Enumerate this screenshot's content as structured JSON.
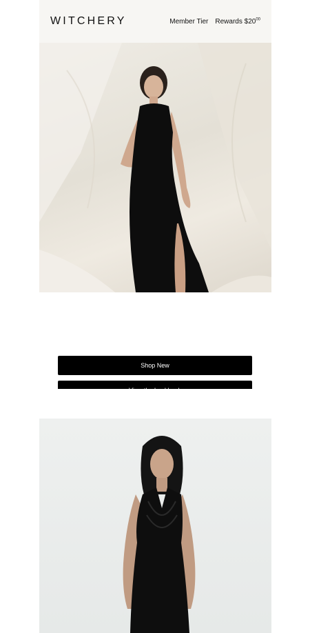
{
  "header": {
    "logo": "WITCHERY",
    "member_tier": "Member Tier",
    "rewards_label": "Rewards $20",
    "rewards_cents": "00"
  },
  "hero_1": {
    "alt": "Model in black sleeveless midi dress with side split"
  },
  "hero_2": {
    "alt": "Model in black cowl neck halter dress"
  },
  "buttons": {
    "shop_new": "Shop New",
    "second": "View the Lookbook"
  },
  "colors": {
    "header_bg": "#f7f6f3",
    "button_bg": "#000000",
    "button_text": "#ffffff"
  }
}
